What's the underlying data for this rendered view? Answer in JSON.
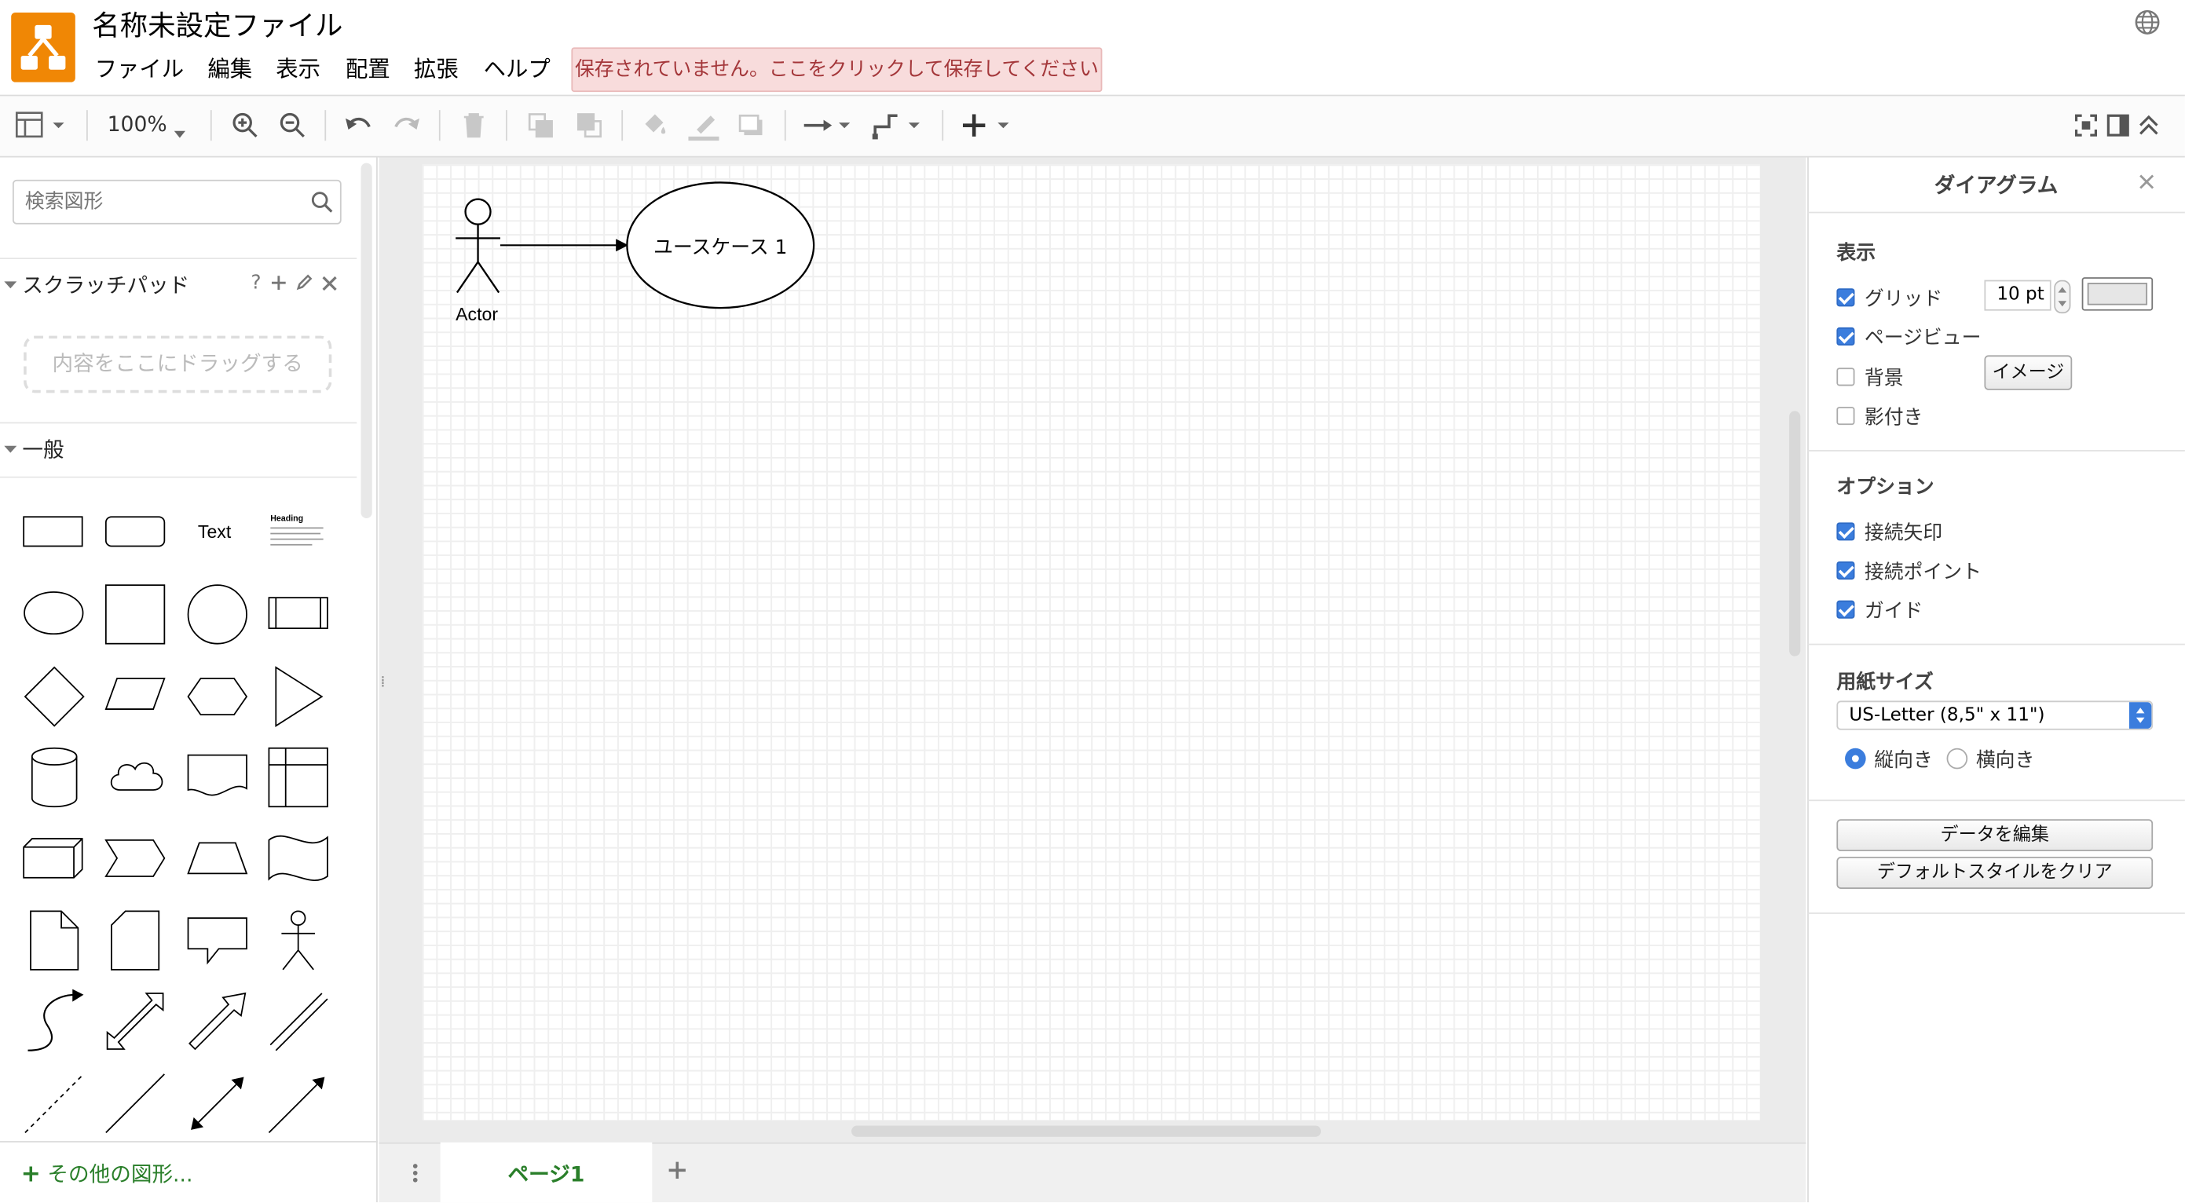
{
  "app": {
    "title": "名称未設定ファイル",
    "menu": [
      "ファイル",
      "編集",
      "表示",
      "配置",
      "拡張",
      "ヘルプ"
    ],
    "unsaved_notice": "保存されていません。ここをクリックして保存してください",
    "accent_color": "#f08705"
  },
  "toolbar": {
    "zoom": "100%",
    "icons": [
      "format-panel-icon",
      "zoom-in-icon",
      "zoom-out-icon",
      "undo-icon",
      "redo-icon",
      "delete-icon",
      "to-front-icon",
      "to-back-icon",
      "fill-color-icon",
      "line-color-icon",
      "shadow-icon",
      "connection-icon",
      "waypoints-icon",
      "insert-icon",
      "fullscreen-icon",
      "toggle-panel-icon",
      "collapse-icon"
    ]
  },
  "left_panel": {
    "search_placeholder": "検索図形",
    "scratchpad": {
      "title": "スクラッチパッド",
      "help": "?",
      "drop_hint": "内容をここにドラッグする"
    },
    "general": {
      "title": "一般",
      "text_shape": "Text",
      "heading_shape": "Heading"
    },
    "more_shapes": "その他の図形..."
  },
  "canvas": {
    "actor_label": "Actor",
    "usecase_label": "ユースケース 1"
  },
  "bottom": {
    "page_tab": "ページ1"
  },
  "right_panel": {
    "title": "ダイアグラム",
    "view": {
      "heading": "表示",
      "grid": {
        "label": "グリッド",
        "checked": true,
        "size": "10 pt"
      },
      "page_view": {
        "label": "ページビュー",
        "checked": true
      },
      "background": {
        "label": "背景",
        "checked": false
      },
      "image_button": "イメージ",
      "shadow": {
        "label": "影付き",
        "checked": false
      }
    },
    "options": {
      "heading": "オプション",
      "connection_arrows": {
        "label": "接続矢印",
        "checked": true
      },
      "connection_points": {
        "label": "接続ポイント",
        "checked": true
      },
      "guides": {
        "label": "ガイド",
        "checked": true
      }
    },
    "paper": {
      "heading": "用紙サイズ",
      "size": "US-Letter (8,5\" x 11\")",
      "portrait": "縦向き",
      "landscape": "横向き",
      "selected": "縦向き"
    },
    "edit_data": "データを編集",
    "clear_style": "デフォルトスタイルをクリア"
  }
}
